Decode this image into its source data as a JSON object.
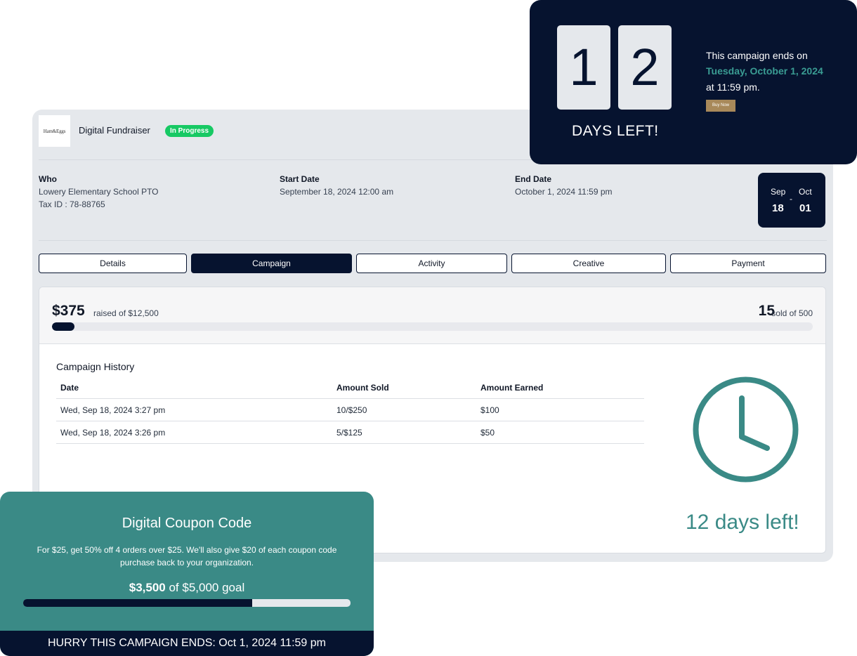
{
  "header": {
    "logo_text": "Ham&Eggs",
    "app_title": "Digital Fundraiser",
    "status": "In Progress"
  },
  "info": {
    "who_label": "Who",
    "who_value": "Lowery Elementary School PTO",
    "tax_id": "Tax ID : 78-88765",
    "start_label": "Start Date",
    "start_value": "September 18, 2024 12:00 am",
    "end_label": "End Date",
    "end_value": "October 1, 2024 11:59 pm"
  },
  "date_chip": {
    "start_month": "Sep",
    "start_day": "18",
    "sep": "-",
    "end_month": "Oct",
    "end_day": "01"
  },
  "tabs": [
    {
      "label": "Details",
      "active": false
    },
    {
      "label": "Campaign",
      "active": true
    },
    {
      "label": "Activity",
      "active": false
    },
    {
      "label": "Creative",
      "active": false
    },
    {
      "label": "Payment",
      "active": false
    }
  ],
  "progress": {
    "raised": "$375",
    "raised_of": "raised of $12,500",
    "raised_fraction": 0.03,
    "sold": "15",
    "sold_of": "sold of 500"
  },
  "history": {
    "title": "Campaign History",
    "columns": [
      "Date",
      "Amount Sold",
      "Amount Earned"
    ],
    "rows": [
      [
        "Wed, Sep 18, 2024 3:27 pm",
        "10/$250",
        "$100"
      ],
      [
        "Wed, Sep 18, 2024 3:26 pm",
        "5/$125",
        "$50"
      ]
    ]
  },
  "clock_widget": {
    "icon": "clock-icon",
    "text": "12 days left!",
    "color": "#3a8a86"
  },
  "countdown": {
    "digits": [
      "1",
      "2"
    ],
    "caption": "DAYS LEFT!",
    "ends_on": "This campaign ends on",
    "ends_date": "Tuesday, October 1, 2024",
    "ends_time": "at 11:59 pm.",
    "buy_now": "Buy Now"
  },
  "coupon": {
    "title": "Digital Coupon Code",
    "description": "For $25, get 50% off 4 orders over $25.  We'll also give $20 of each coupon code purchase back to your organization.",
    "goal_amount": "$3,500",
    "goal_rest": " of $5,000 goal",
    "goal_fraction": 0.7,
    "footer": "HURRY THIS CAMPAIGN ENDS: Oct 1, 2024 11:59 pm"
  },
  "colors": {
    "navy": "#06132f",
    "teal": "#3a8a86",
    "badge_green": "#17c964",
    "gold": "#a8895a",
    "panel_gray": "#e5e8ec"
  }
}
